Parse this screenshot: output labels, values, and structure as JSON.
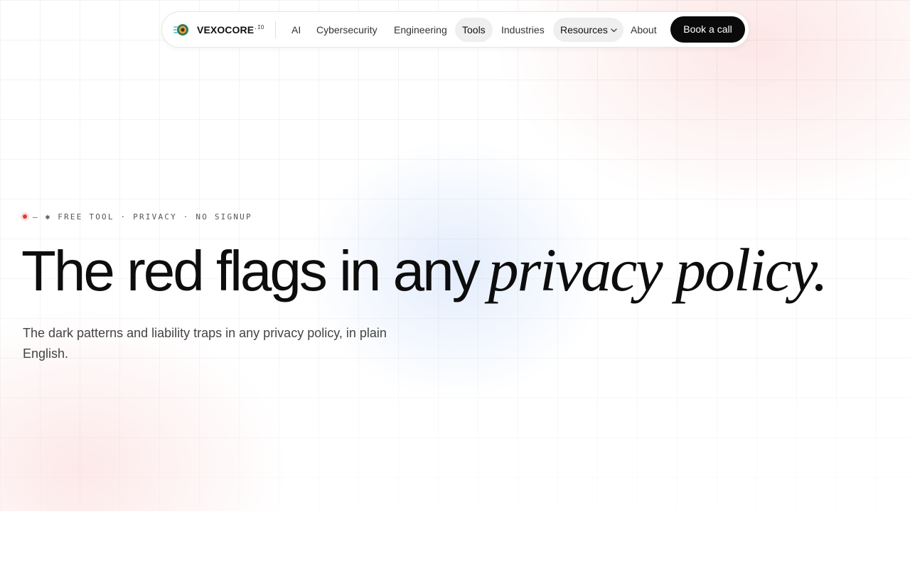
{
  "nav": {
    "brand": "VEXOCORE",
    "brand_suffix": ".IO",
    "items": [
      {
        "label": "AI"
      },
      {
        "label": "Cybersecurity"
      },
      {
        "label": "Engineering"
      },
      {
        "label": "Tools",
        "active": true
      },
      {
        "label": "Industries"
      },
      {
        "label": "Resources",
        "has_dropdown": true,
        "icon": "chevron-down-icon"
      },
      {
        "label": "About"
      }
    ],
    "cta_label": "Book a call"
  },
  "hero": {
    "eyebrow": "— ✱ FREE TOOL · PRIVACY · NO SIGNUP",
    "headline_plain": "The red flags in any",
    "headline_italic": "privacy policy.",
    "subtitle": "The dark patterns and liability traps in any privacy policy, in plain English."
  },
  "colors": {
    "accent_dot": "#e53935",
    "cta_background": "#0a0a0a",
    "text": "#0d0d0d"
  }
}
